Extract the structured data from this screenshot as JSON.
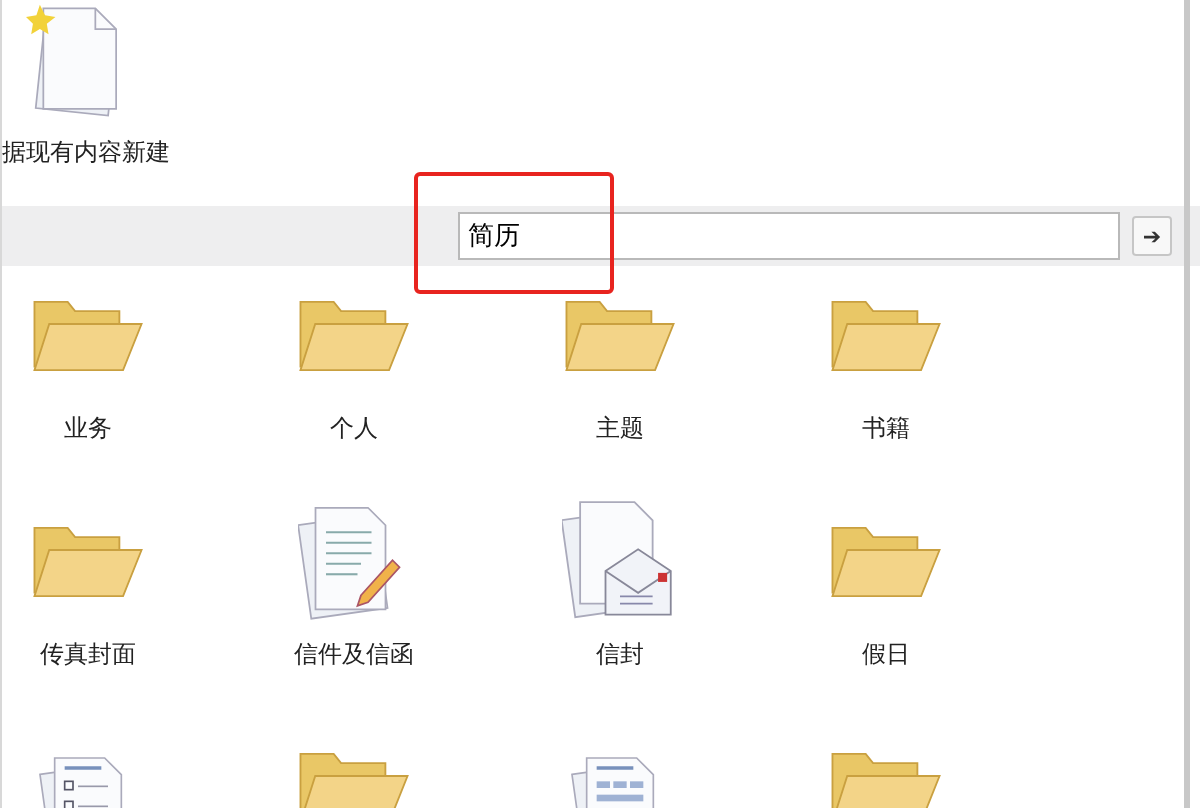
{
  "top_item": {
    "label": "据现有内容新建"
  },
  "search": {
    "value": "简历",
    "button": "➔",
    "highlighted": true
  },
  "templates": [
    {
      "kind": "folder",
      "label": "业务"
    },
    {
      "kind": "folder",
      "label": "个人"
    },
    {
      "kind": "folder",
      "label": "主题"
    },
    {
      "kind": "folder",
      "label": "书籍"
    },
    {
      "kind": "folder",
      "label": "传真封面"
    },
    {
      "kind": "letter",
      "label": "信件及信函"
    },
    {
      "kind": "envelope",
      "label": "信封"
    },
    {
      "kind": "folder",
      "label": "假日"
    },
    {
      "kind": "checklist"
    },
    {
      "kind": "folder"
    },
    {
      "kind": "form"
    },
    {
      "kind": "folder"
    }
  ]
}
